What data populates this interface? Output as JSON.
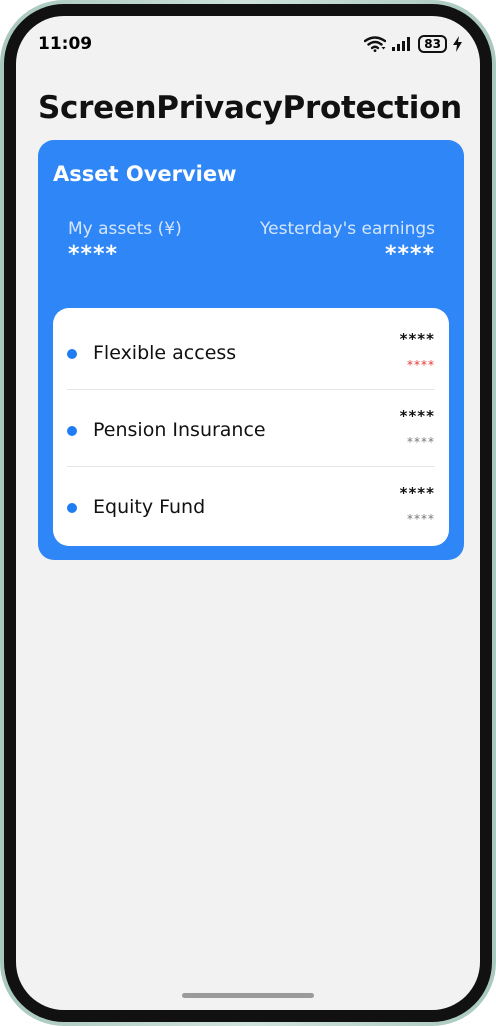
{
  "status_bar": {
    "time": "11:09",
    "battery": "83",
    "icons": [
      "wifi-icon",
      "signal-icon",
      "battery-icon",
      "charging-icon"
    ]
  },
  "page": {
    "title": "ScreenPrivacyProtection"
  },
  "asset_overview": {
    "title": "Asset Overview",
    "my_assets_label": "My assets (¥)",
    "my_assets_value": "****",
    "yesterday_label": "Yesterday's earnings",
    "yesterday_value": "****"
  },
  "products": [
    {
      "name": "Flexible access",
      "value": "****",
      "change": "****",
      "change_color": "#e53935"
    },
    {
      "name": "Pension Insurance",
      "value": "****",
      "change": "****",
      "change_color": "#777777"
    },
    {
      "name": "Equity Fund",
      "value": "****",
      "change": "****",
      "change_color": "#777777"
    }
  ],
  "colors": {
    "accent": "#2f86f6",
    "dot": "#1f7cf3",
    "background": "#f2f2f2"
  }
}
